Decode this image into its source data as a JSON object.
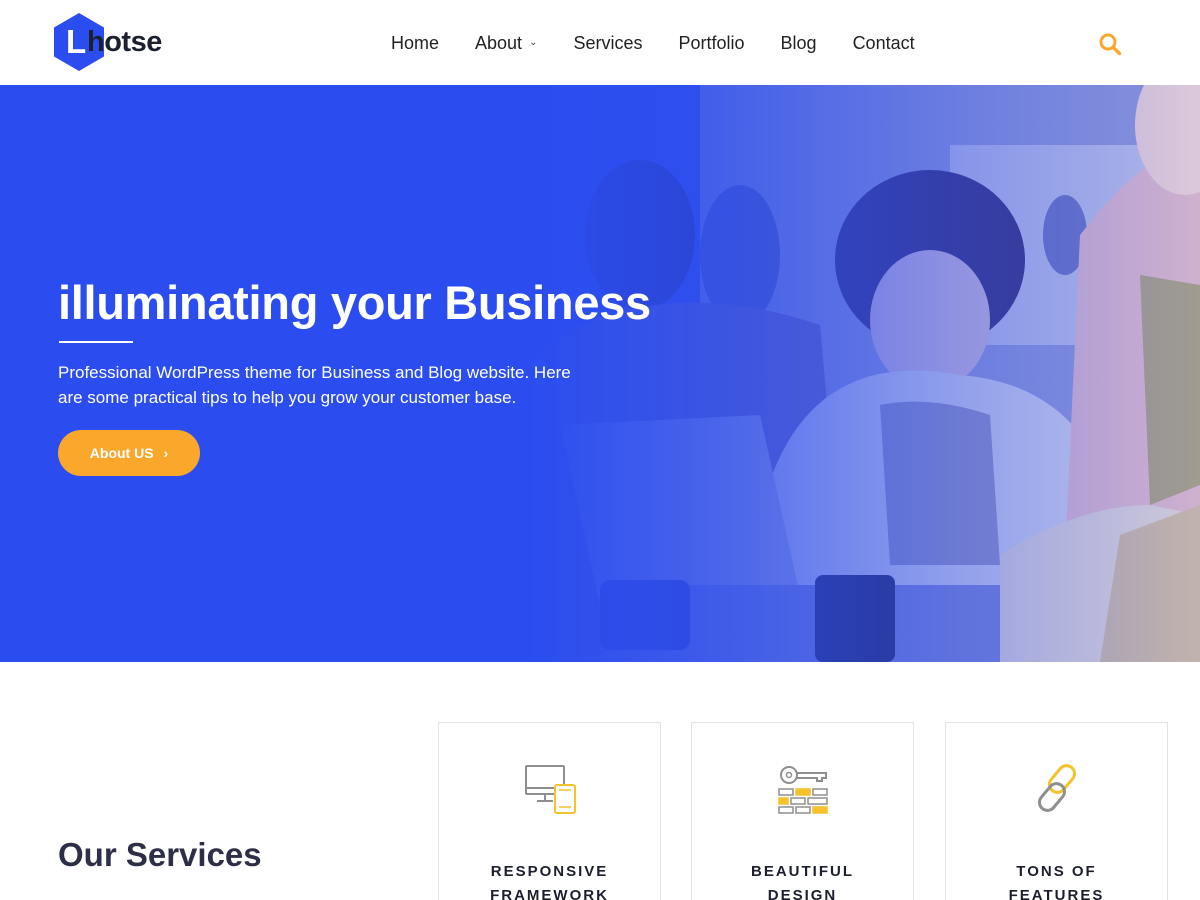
{
  "brand": {
    "logo_letter": "L",
    "logo_rest": "hotse",
    "logo_color": "#2b4df0"
  },
  "nav": {
    "items": [
      {
        "label": "Home"
      },
      {
        "label": "About",
        "has_dropdown": true
      },
      {
        "label": "Services"
      },
      {
        "label": "Portfolio"
      },
      {
        "label": "Blog"
      },
      {
        "label": "Contact"
      }
    ],
    "search_icon": "search-icon",
    "search_color": "#fba72c"
  },
  "hero": {
    "title": "illuminating your Business",
    "text": "Professional WordPress theme for Business and Blog website. Here are some practical tips to help you grow your customer base.",
    "button_label": "About US",
    "button_color": "#fba72c",
    "background_color": "#2b4df0"
  },
  "services": {
    "title": "Our Services",
    "cards": [
      {
        "icon": "responsive-devices-icon",
        "label": "RESPONSIVE FRAMEWORK"
      },
      {
        "icon": "key-design-icon",
        "label": "BEAUTIFUL DESIGN"
      },
      {
        "icon": "chain-link-icon",
        "label": "TONS OF FEATURES"
      }
    ]
  }
}
